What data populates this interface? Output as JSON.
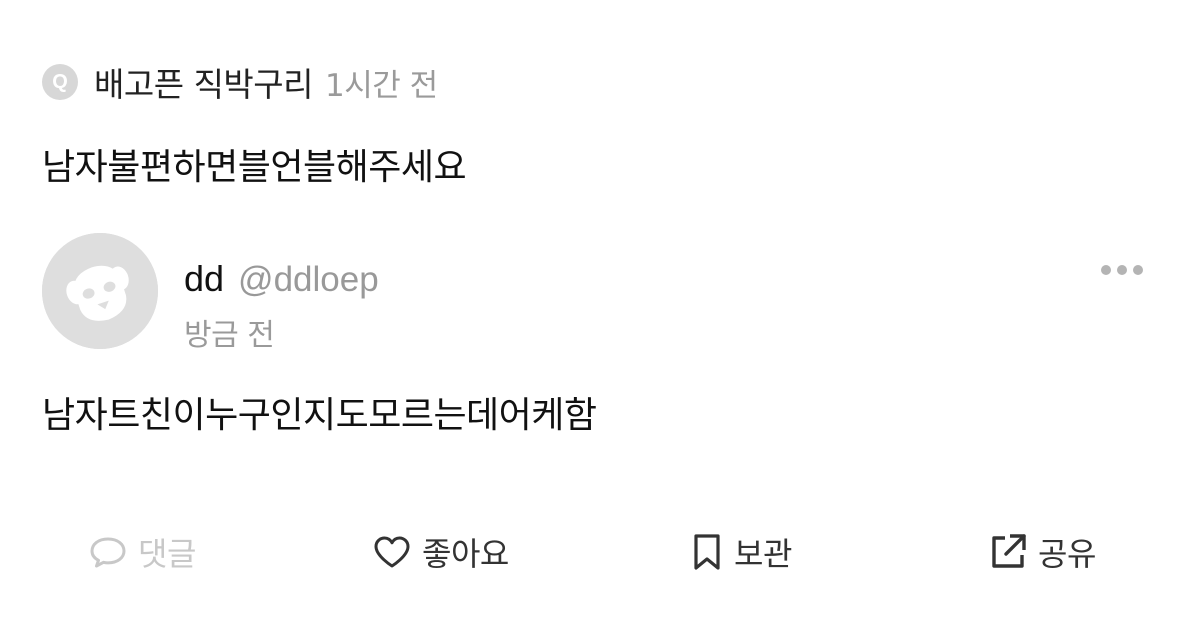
{
  "question": {
    "badge": "Q",
    "asker": "배고픈 직박구리",
    "time": "1시간 전",
    "text": "남자불편하면블언블해주세요"
  },
  "answer": {
    "author_name": "dd",
    "author_handle": "@ddloep",
    "time": "방금 전",
    "text": "남자트친이누구인지도모르는데어케함",
    "avatar_icon": "default-avatar-icon"
  },
  "menu": {
    "icon": "more-options-icon"
  },
  "actions": {
    "comment": {
      "label": "댓글",
      "icon": "comment-icon",
      "state": "disabled"
    },
    "like": {
      "label": "좋아요",
      "icon": "heart-icon"
    },
    "save": {
      "label": "보관",
      "icon": "bookmark-icon"
    },
    "share": {
      "label": "공유",
      "icon": "share-icon"
    }
  },
  "colors": {
    "primary_text": "#111111",
    "secondary_text": "#9a9a9a",
    "disabled": "#c8c8c8",
    "avatar_bg": "#dedede"
  }
}
